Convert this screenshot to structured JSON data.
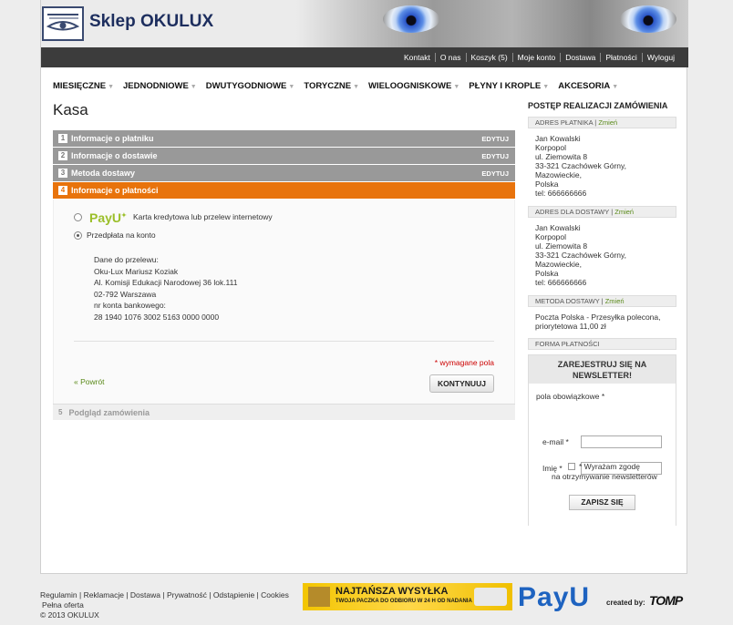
{
  "header": {
    "logo_text": "Sklep OKULUX"
  },
  "top_links": [
    "Kontakt",
    "O nas",
    "Koszyk (5)",
    "Moje konto",
    "Dostawa",
    "Płatności",
    "Wyloguj"
  ],
  "nav": [
    "MIESIĘCZNE",
    "JEDNODNIOWE",
    "DWUTYGODNIOWE",
    "TORYCZNE",
    "WIELOOGNISKOWE",
    "PŁYNY I KROPLE",
    "AKCESORIA"
  ],
  "page_title": "Kasa",
  "steps": [
    {
      "num": "1",
      "label": "Informacje o płatniku",
      "edit": "EDYTUJ"
    },
    {
      "num": "2",
      "label": "Informacje o dostawie",
      "edit": "EDYTUJ"
    },
    {
      "num": "3",
      "label": "Metoda dostawy",
      "edit": "EDYTUJ"
    },
    {
      "num": "4",
      "label": "Informacje o płatności"
    },
    {
      "num": "5",
      "label": "Podgląd zamówienia"
    }
  ],
  "payment": {
    "payu_logo": "PayU",
    "option_card": "Karta kredytowa lub przelew internetowy",
    "option_prepay": "Przedpłata na konto",
    "transfer": [
      "Dane do przelewu:",
      "Oku-Lux Mariusz Koziak",
      "Al. Komisji Edukacji Narodowej 36 lok.111",
      "02-792 Warszawa",
      "nr konta bankowego:",
      "28 1940 1076 3002 5163 0000 0000"
    ],
    "required_note": "* wymagane pola",
    "back_link": "« Powrót",
    "continue_button": "KONTYNUUJ"
  },
  "sidebar": {
    "title": "POSTĘP REALIZACJI ZAMÓWIENIA",
    "change_label": "Zmień",
    "payer_head": "ADRES PŁATNIKA",
    "payer": [
      "Jan Kowalski",
      "Korpopol",
      "ul. Ziemowita 8",
      "33-321 Czachówek Górny,",
      "Mazowieckie,",
      "Polska",
      "tel: 666666666"
    ],
    "shipping_head": "ADRES DLA DOSTAWY",
    "shipping": [
      "Jan Kowalski",
      "Korpopol",
      "ul. Ziemowita 8",
      "33-321 Czachówek Górny,",
      "Mazowieckie,",
      "Polska",
      "tel: 666666666"
    ],
    "method_head": "METODA DOSTAWY",
    "method": [
      "Poczta Polska - Przesyłka polecona,",
      "priorytetowa 11,00 zł"
    ],
    "payment_head": "FORMA PŁATNOŚCI"
  },
  "newsletter": {
    "title_line1": "ZAREJESTRUJ SIĘ NA",
    "title_line2": "NEWSLETTER!",
    "required_fields": "pola obowiązkowe *",
    "email_label": "e-mail *",
    "name_label": "Imię *",
    "consent_line1": "* Wyrażam zgodę",
    "consent_line2": "na otrzymywanie newsletterów",
    "submit": "ZAPISZ SIĘ"
  },
  "footer": {
    "links": [
      "Regulamin",
      "Reklamacje",
      "Dostawa",
      "Prywatność",
      "Odstąpienie",
      "Cookies",
      "Pełna oferta"
    ],
    "copyright": "© 2013 OKULUX",
    "banner_title": "NAJTAŃSZA WYSYŁKA",
    "banner_sub": "TWOJA PACZKA DO ODBIORU W 24 H OD NADANIA",
    "payu": "PayU",
    "created_by": "created by:",
    "tomp": "TOMP"
  }
}
